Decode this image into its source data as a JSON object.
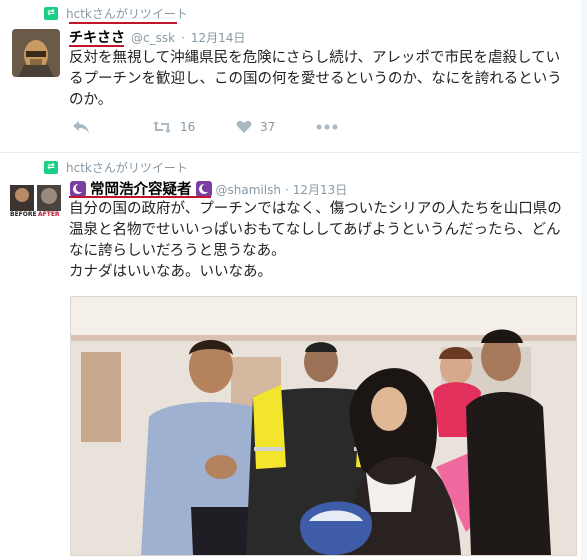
{
  "tweet1": {
    "retweeted_by": "hctkさんがリツイート",
    "display_name": "チキささ",
    "handle": "@c_ssk",
    "separator": "·",
    "date": "12月14日",
    "text": "反対を無視して沖縄県民を危険にさらし続け、アレッポで市民を虐殺しているプーチンを歓迎し、この国の何を愛せるというのか、なにを誇れるというのか。",
    "retweet_count": "16",
    "like_count": "37"
  },
  "tweet2": {
    "retweeted_by": "hctkさんがリツイート",
    "display_name": "常岡浩介容疑者",
    "handle": "@shamilsh",
    "separator": "·",
    "date": "12月13日",
    "text_line1": "自分の国の政府が、プーチンではなく、傷ついたシリアの人たちを山口県の温泉と名物でせいいっぱいおもてなししてあげようというんだったら、どんなに誇らしいだろうと思うなあ。",
    "text_line2": "カナダはいいなあ。いいなあ。",
    "avatar_label_before": "BEFORE",
    "avatar_label_after": "AFTER"
  },
  "colors": {
    "retweet_green": "#19cf86",
    "underline_red": "#c0152a",
    "crescent_purple": "#7b3fa0",
    "meta_gray": "#8899a6"
  },
  "icons": [
    "retweet-icon",
    "reply-icon",
    "heart-icon",
    "more-icon",
    "crescent-icon"
  ]
}
